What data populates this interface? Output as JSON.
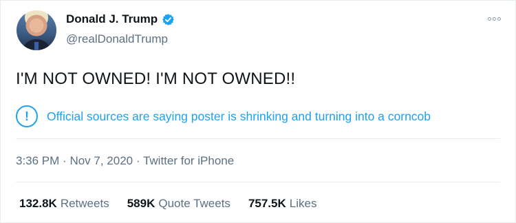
{
  "author": {
    "name": "Donald J. Trump",
    "handle": "@realDonaldTrump",
    "verified": true
  },
  "tweet": {
    "text": "I'M NOT OWNED! I'M NOT OWNED!!",
    "notice": "Official sources are saying poster is shrinking and turning into a corncob",
    "time": "3:36 PM",
    "date": "Nov 7, 2020",
    "source": "Twitter for iPhone"
  },
  "stats": [
    {
      "count": "132.8K",
      "label": "Retweets"
    },
    {
      "count": "589K",
      "label": "Quote Tweets"
    },
    {
      "count": "757.5K",
      "label": "Likes"
    }
  ],
  "colors": {
    "accent": "#1da1f2",
    "secondary_text": "#5b7083",
    "primary_text": "#0f1419",
    "divider": "#e6ecf0"
  },
  "icons": {
    "verified": "verified-badge-icon",
    "notice": "info-exclamation-icon",
    "more": "more-options-icon"
  }
}
